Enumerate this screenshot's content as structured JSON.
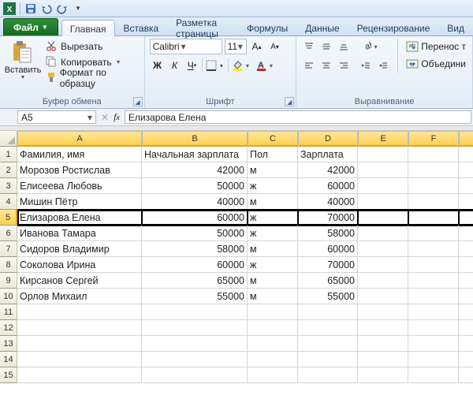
{
  "qat": {
    "save": "save",
    "undo": "undo",
    "redo": "redo"
  },
  "file_label": "Файл",
  "tabs": [
    "Главная",
    "Вставка",
    "Разметка страницы",
    "Формулы",
    "Данные",
    "Рецензирование",
    "Вид"
  ],
  "active_tab": 0,
  "clipboard": {
    "paste": "Вставить",
    "cut": "Вырезать",
    "copy": "Копировать",
    "format_painter": "Формат по образцу",
    "group": "Буфер обмена"
  },
  "font": {
    "name": "Calibri",
    "size": "11",
    "group": "Шрифт"
  },
  "align": {
    "wrap": "Перенос т",
    "merge": "Объедини",
    "group": "Выравнивание"
  },
  "namebox": "A5",
  "formula": "Елизарова Елена",
  "columns": [
    "A",
    "B",
    "C",
    "D",
    "E",
    "F"
  ],
  "headers": {
    "A": "Фамилия, имя",
    "B": "Начальная зарплата",
    "C": "Пол",
    "D": "Зарплата"
  },
  "selected_row": 5,
  "rows": [
    {
      "n": 1,
      "A": "Фамилия, имя",
      "B": "Начальная зарплата",
      "C": "Пол",
      "D": "Зарплата",
      "btxt": true
    },
    {
      "n": 2,
      "A": "Морозов Ростислав",
      "B": "42000",
      "C": "м",
      "D": "42000"
    },
    {
      "n": 3,
      "A": "Елисеева Любовь",
      "B": "50000",
      "C": "ж",
      "D": "60000"
    },
    {
      "n": 4,
      "A": "Мишин Пётр",
      "B": "40000",
      "C": "м",
      "D": "40000"
    },
    {
      "n": 5,
      "A": "Елизарова Елена",
      "B": "60000",
      "C": "ж",
      "D": "70000"
    },
    {
      "n": 6,
      "A": "Иванова Тамара",
      "B": "50000",
      "C": "ж",
      "D": "58000"
    },
    {
      "n": 7,
      "A": "Сидоров Владимир",
      "B": "58000",
      "C": "м",
      "D": "60000"
    },
    {
      "n": 8,
      "A": "Соколова Ирина",
      "B": "60000",
      "C": "ж",
      "D": "70000"
    },
    {
      "n": 9,
      "A": "Кирсанов Сергей",
      "B": "65000",
      "C": "м",
      "D": "65000"
    },
    {
      "n": 10,
      "A": "Орлов Михаил",
      "B": "55000",
      "C": "м",
      "D": "55000"
    },
    {
      "n": 11
    },
    {
      "n": 12
    },
    {
      "n": 13
    },
    {
      "n": 14
    },
    {
      "n": 15
    }
  ]
}
